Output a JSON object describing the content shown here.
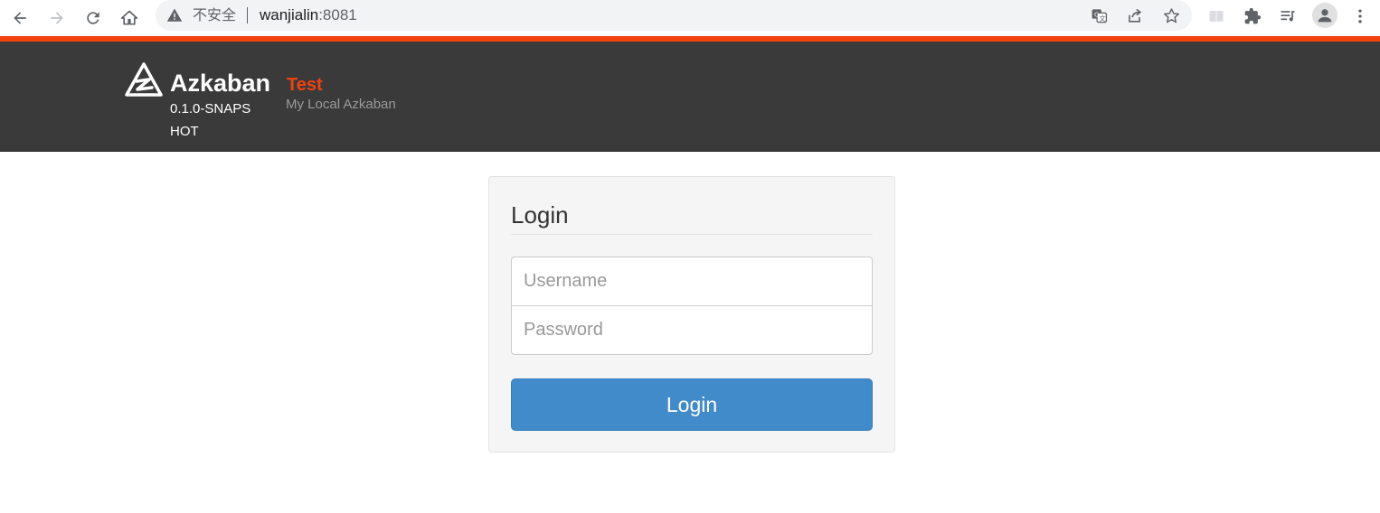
{
  "browser": {
    "security_label": "不安全",
    "url_host": "wanjialin",
    "url_port": ":8081",
    "icons": {
      "back": "back-arrow-icon",
      "forward": "forward-arrow-icon",
      "reload": "reload-icon",
      "home": "home-icon",
      "warning": "warning-triangle-icon",
      "translate": "translate-icon",
      "share": "share-icon",
      "bookmark": "star-icon",
      "reading": "reading-mode-icon",
      "extensions": "puzzle-icon",
      "media": "media-queue-icon",
      "profile": "profile-icon",
      "menu": "kebab-menu-icon"
    }
  },
  "header": {
    "brand": "Azkaban",
    "version": "0.1.0-SNAPSHOT",
    "env_name": "Test",
    "env_description": "My Local Azkaban",
    "colors": {
      "accent": "#f1420f",
      "background": "#3a3a3a"
    }
  },
  "login": {
    "title": "Login",
    "username_placeholder": "Username",
    "password_placeholder": "Password",
    "username_value": "",
    "password_value": "",
    "submit_label": "Login",
    "button_color": "#428bca"
  }
}
